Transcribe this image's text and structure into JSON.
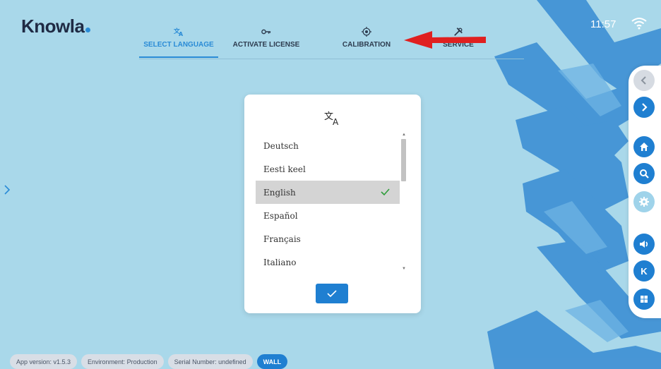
{
  "brand": {
    "name": "Knowla",
    "dot_color": "#2a8bd6"
  },
  "status": {
    "time": "11:57"
  },
  "tabs": [
    {
      "label": "SELECT LANGUAGE",
      "icon": "translate-icon",
      "active": true
    },
    {
      "label": "ACTIVATE LICENSE",
      "icon": "key-icon",
      "active": false
    },
    {
      "label": "CALIBRATION",
      "icon": "target-icon",
      "active": false
    },
    {
      "label": "SERVICE",
      "icon": "tools-icon",
      "active": false
    }
  ],
  "languages": [
    {
      "label": "Deutsch",
      "selected": false
    },
    {
      "label": "Eesti keel",
      "selected": false
    },
    {
      "label": "English",
      "selected": true
    },
    {
      "label": "Español",
      "selected": false
    },
    {
      "label": "Français",
      "selected": false
    },
    {
      "label": "Italiano",
      "selected": false
    }
  ],
  "sidebar": [
    {
      "icon": "back-chevron-icon",
      "state": "inactive"
    },
    {
      "icon": "forward-chevron-icon",
      "state": "active"
    },
    {
      "icon": "home-icon",
      "state": "active"
    },
    {
      "icon": "search-icon",
      "state": "active"
    },
    {
      "icon": "settings-gear-icon",
      "state": "disabled"
    },
    {
      "icon": "volume-icon",
      "state": "active"
    },
    {
      "icon": "knowla-k-icon",
      "label": "K",
      "state": "active"
    },
    {
      "icon": "windows-icon",
      "state": "active"
    }
  ],
  "footer": {
    "app_version": "App version: v1.5.3",
    "environment": "Environment: Production",
    "serial": "Serial Number: undefined",
    "mode": "WALL"
  },
  "colors": {
    "background": "#a9d8ea",
    "accent": "#1f7fd1",
    "brush": "#3d8fd4",
    "arrow": "#e02020",
    "check": "#2e9d3a"
  }
}
